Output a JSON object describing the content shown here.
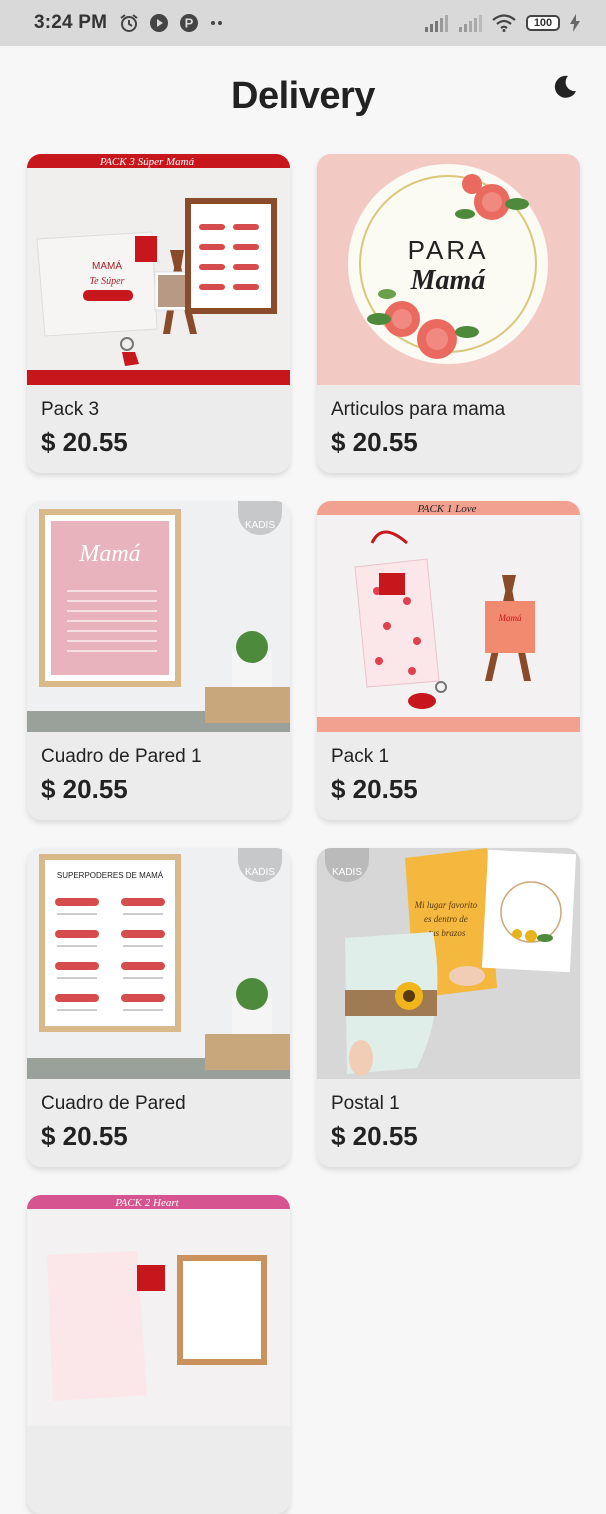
{
  "status_bar": {
    "time": "3:24 PM",
    "battery": "100",
    "icons": [
      "alarm-icon",
      "play-icon",
      "p-app-icon",
      "signal-icon",
      "signal-icon",
      "wifi-icon",
      "battery-icon",
      "charging-icon"
    ]
  },
  "header": {
    "title": "Delivery",
    "theme_icon": "moon-icon"
  },
  "products": [
    {
      "name": "Pack 3",
      "price": "$ 20.55",
      "banner_text": "PACK 3  Súper Mamá"
    },
    {
      "name": "Articulos para mama",
      "price": "$ 20.55",
      "banner_text": "PARA",
      "banner_text2": "Mamá"
    },
    {
      "name": "Cuadro de Pared 1",
      "price": "$ 20.55",
      "banner_text": "Mamá",
      "watermark": "KADIS"
    },
    {
      "name": "Pack 1",
      "price": "$ 20.55",
      "banner_text": "PACK 1  Love"
    },
    {
      "name": "Cuadro de Pared",
      "price": "$ 20.55",
      "banner_text": "SUPERPODERES DE MAMÁ",
      "watermark": "KADIS"
    },
    {
      "name": "Postal 1",
      "price": "$ 20.55",
      "banner_text": "Mi lugar favorito es dentro de tus brazos",
      "watermark": "KADIS"
    },
    {
      "name": "",
      "price": "",
      "banner_text": "PACK 2  Heart"
    }
  ],
  "colors": {
    "background": "#f7f7f7",
    "card": "#ececec",
    "status_bar": "#d9d9d9",
    "accent_red": "#c8161d"
  }
}
